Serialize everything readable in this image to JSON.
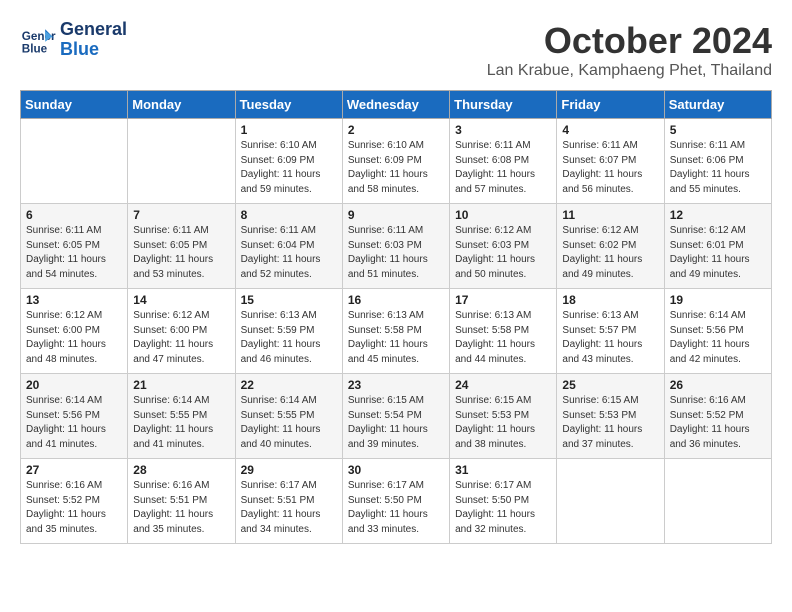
{
  "header": {
    "logo_line1": "General",
    "logo_line2": "Blue",
    "month": "October 2024",
    "location": "Lan Krabue, Kamphaeng Phet, Thailand"
  },
  "weekdays": [
    "Sunday",
    "Monday",
    "Tuesday",
    "Wednesday",
    "Thursday",
    "Friday",
    "Saturday"
  ],
  "weeks": [
    [
      {
        "day": "",
        "info": ""
      },
      {
        "day": "",
        "info": ""
      },
      {
        "day": "1",
        "info": "Sunrise: 6:10 AM\nSunset: 6:09 PM\nDaylight: 11 hours and 59 minutes."
      },
      {
        "day": "2",
        "info": "Sunrise: 6:10 AM\nSunset: 6:09 PM\nDaylight: 11 hours and 58 minutes."
      },
      {
        "day": "3",
        "info": "Sunrise: 6:11 AM\nSunset: 6:08 PM\nDaylight: 11 hours and 57 minutes."
      },
      {
        "day": "4",
        "info": "Sunrise: 6:11 AM\nSunset: 6:07 PM\nDaylight: 11 hours and 56 minutes."
      },
      {
        "day": "5",
        "info": "Sunrise: 6:11 AM\nSunset: 6:06 PM\nDaylight: 11 hours and 55 minutes."
      }
    ],
    [
      {
        "day": "6",
        "info": "Sunrise: 6:11 AM\nSunset: 6:05 PM\nDaylight: 11 hours and 54 minutes."
      },
      {
        "day": "7",
        "info": "Sunrise: 6:11 AM\nSunset: 6:05 PM\nDaylight: 11 hours and 53 minutes."
      },
      {
        "day": "8",
        "info": "Sunrise: 6:11 AM\nSunset: 6:04 PM\nDaylight: 11 hours and 52 minutes."
      },
      {
        "day": "9",
        "info": "Sunrise: 6:11 AM\nSunset: 6:03 PM\nDaylight: 11 hours and 51 minutes."
      },
      {
        "day": "10",
        "info": "Sunrise: 6:12 AM\nSunset: 6:03 PM\nDaylight: 11 hours and 50 minutes."
      },
      {
        "day": "11",
        "info": "Sunrise: 6:12 AM\nSunset: 6:02 PM\nDaylight: 11 hours and 49 minutes."
      },
      {
        "day": "12",
        "info": "Sunrise: 6:12 AM\nSunset: 6:01 PM\nDaylight: 11 hours and 49 minutes."
      }
    ],
    [
      {
        "day": "13",
        "info": "Sunrise: 6:12 AM\nSunset: 6:00 PM\nDaylight: 11 hours and 48 minutes."
      },
      {
        "day": "14",
        "info": "Sunrise: 6:12 AM\nSunset: 6:00 PM\nDaylight: 11 hours and 47 minutes."
      },
      {
        "day": "15",
        "info": "Sunrise: 6:13 AM\nSunset: 5:59 PM\nDaylight: 11 hours and 46 minutes."
      },
      {
        "day": "16",
        "info": "Sunrise: 6:13 AM\nSunset: 5:58 PM\nDaylight: 11 hours and 45 minutes."
      },
      {
        "day": "17",
        "info": "Sunrise: 6:13 AM\nSunset: 5:58 PM\nDaylight: 11 hours and 44 minutes."
      },
      {
        "day": "18",
        "info": "Sunrise: 6:13 AM\nSunset: 5:57 PM\nDaylight: 11 hours and 43 minutes."
      },
      {
        "day": "19",
        "info": "Sunrise: 6:14 AM\nSunset: 5:56 PM\nDaylight: 11 hours and 42 minutes."
      }
    ],
    [
      {
        "day": "20",
        "info": "Sunrise: 6:14 AM\nSunset: 5:56 PM\nDaylight: 11 hours and 41 minutes."
      },
      {
        "day": "21",
        "info": "Sunrise: 6:14 AM\nSunset: 5:55 PM\nDaylight: 11 hours and 41 minutes."
      },
      {
        "day": "22",
        "info": "Sunrise: 6:14 AM\nSunset: 5:55 PM\nDaylight: 11 hours and 40 minutes."
      },
      {
        "day": "23",
        "info": "Sunrise: 6:15 AM\nSunset: 5:54 PM\nDaylight: 11 hours and 39 minutes."
      },
      {
        "day": "24",
        "info": "Sunrise: 6:15 AM\nSunset: 5:53 PM\nDaylight: 11 hours and 38 minutes."
      },
      {
        "day": "25",
        "info": "Sunrise: 6:15 AM\nSunset: 5:53 PM\nDaylight: 11 hours and 37 minutes."
      },
      {
        "day": "26",
        "info": "Sunrise: 6:16 AM\nSunset: 5:52 PM\nDaylight: 11 hours and 36 minutes."
      }
    ],
    [
      {
        "day": "27",
        "info": "Sunrise: 6:16 AM\nSunset: 5:52 PM\nDaylight: 11 hours and 35 minutes."
      },
      {
        "day": "28",
        "info": "Sunrise: 6:16 AM\nSunset: 5:51 PM\nDaylight: 11 hours and 35 minutes."
      },
      {
        "day": "29",
        "info": "Sunrise: 6:17 AM\nSunset: 5:51 PM\nDaylight: 11 hours and 34 minutes."
      },
      {
        "day": "30",
        "info": "Sunrise: 6:17 AM\nSunset: 5:50 PM\nDaylight: 11 hours and 33 minutes."
      },
      {
        "day": "31",
        "info": "Sunrise: 6:17 AM\nSunset: 5:50 PM\nDaylight: 11 hours and 32 minutes."
      },
      {
        "day": "",
        "info": ""
      },
      {
        "day": "",
        "info": ""
      }
    ]
  ]
}
